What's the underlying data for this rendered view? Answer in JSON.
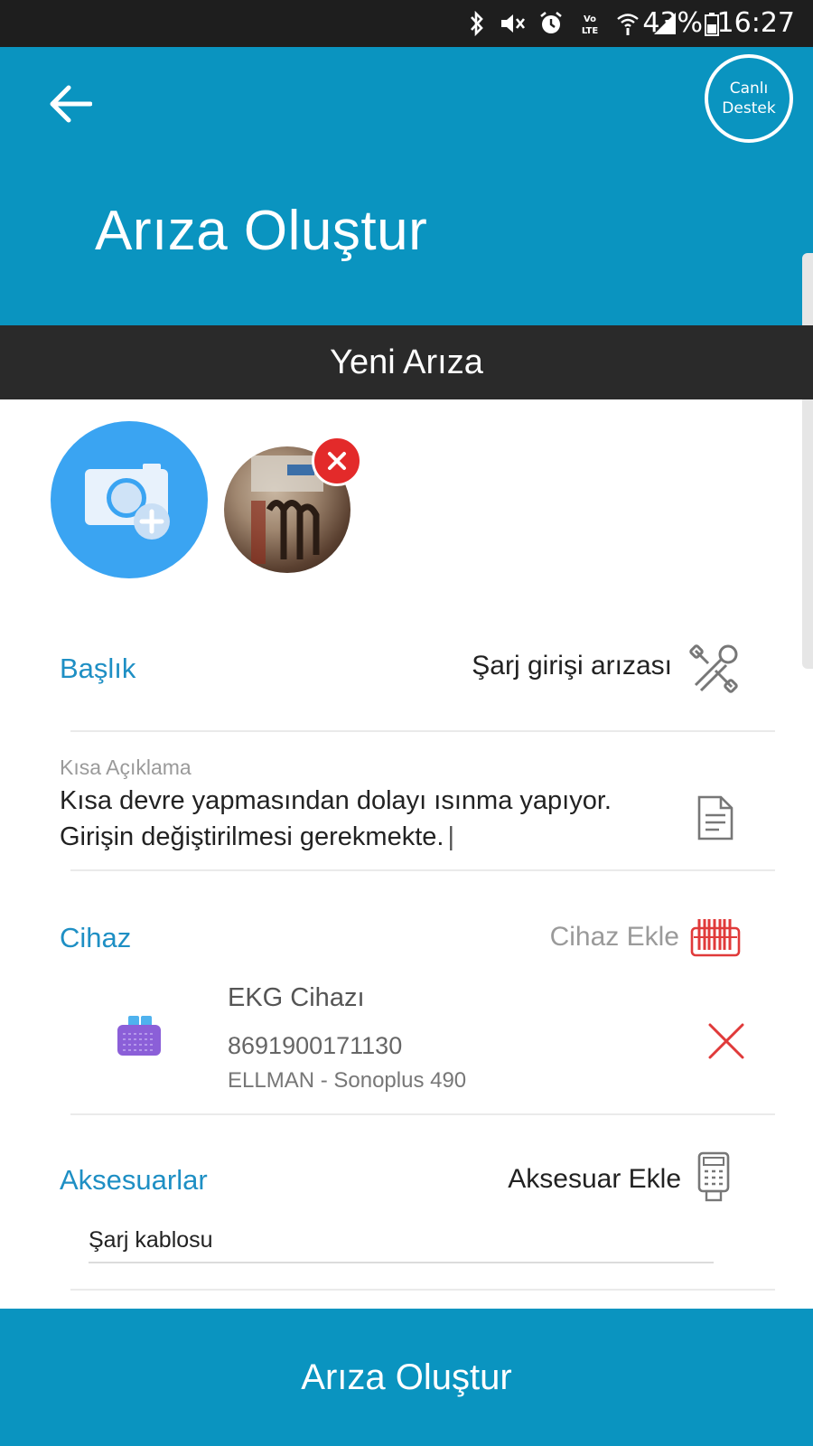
{
  "status_bar": {
    "battery": "43%",
    "time": "16:27",
    "icons": [
      "bluetooth-icon",
      "mute-icon",
      "alarm-icon",
      "volte-icon",
      "wifi-icon",
      "signal-icon",
      "battery-icon"
    ]
  },
  "header": {
    "title": "Arıza Oluştur",
    "support_label": "Canlı Destek",
    "accent_color": "#0a94c0"
  },
  "section": {
    "title": "Yeni Arıza"
  },
  "form": {
    "title_field": {
      "label": "Başlık",
      "value": "Şarj girişi arızası"
    },
    "description_field": {
      "label": "Kısa Açıklama",
      "value": "Kısa devre yapmasından dolayı ısınma yapıyor. Girişin değiştirilmesi gerekmekte."
    },
    "device_section": {
      "label": "Cihaz",
      "add_label": "Cihaz Ekle",
      "device": {
        "name": "EKG Cihazı",
        "barcode": "8691900171130",
        "model": "ELLMAN - Sonoplus 490"
      }
    },
    "accessories_section": {
      "label": "Aksesuarlar",
      "add_label": "Aksesuar Ekle",
      "items": [
        "Şarj kablosu"
      ]
    }
  },
  "submit": {
    "label": "Arıza Oluştur"
  }
}
